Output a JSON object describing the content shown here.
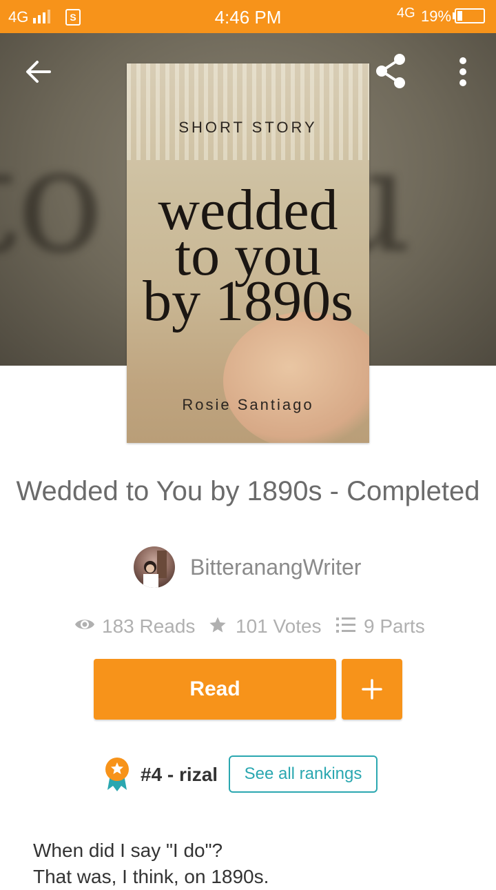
{
  "status_bar": {
    "network_left": "4G",
    "sim_label": "S",
    "time": "4:46 PM",
    "network_right": "4G",
    "battery_pct": "19%",
    "battery_level": 0.19
  },
  "hero": {
    "background_text": "to you"
  },
  "cover": {
    "label": "SHORT STORY",
    "title_line1": "wedded",
    "title_line2": "to you",
    "title_line3": "by 1890s",
    "author": "Rosie Santiago"
  },
  "story": {
    "title": "Wedded to You by 1890s - Completed",
    "author": "BitteranangWriter"
  },
  "stats": {
    "reads": "183 Reads",
    "votes": "101 Votes",
    "parts": "9 Parts"
  },
  "actions": {
    "read_label": "Read",
    "add_label": "+"
  },
  "ranking": {
    "rank": "#4 - rizal",
    "see_all": "See all rankings"
  },
  "description": {
    "line1": "When did I say \"I do\"?",
    "line2": "That was, I think, on 1890s."
  },
  "colors": {
    "accent": "#f7931a",
    "teal": "#2aa7b0",
    "muted_text": "#8a8a8a"
  },
  "icons": [
    "back-arrow-icon",
    "share-icon",
    "more-vert-icon",
    "eye-icon",
    "star-icon",
    "list-icon",
    "plus-icon",
    "ribbon-icon"
  ]
}
